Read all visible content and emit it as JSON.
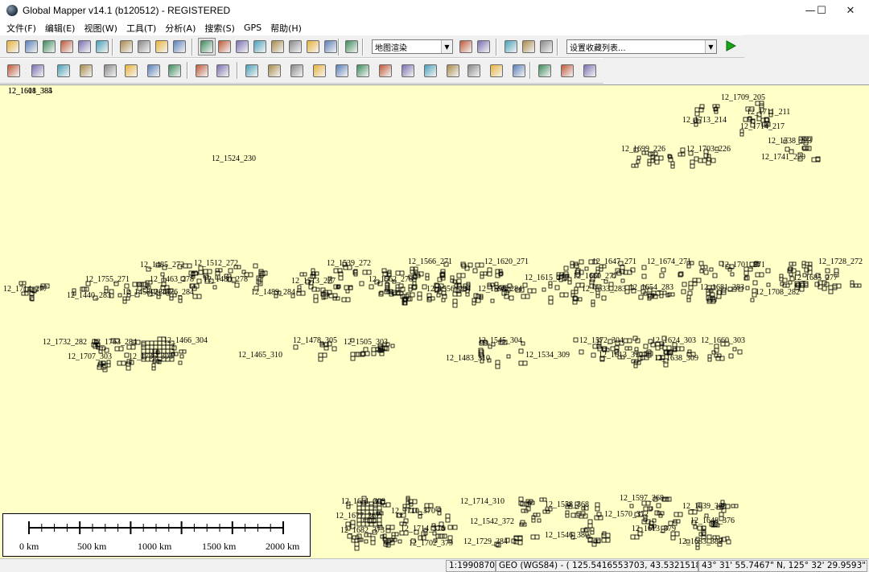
{
  "window": {
    "title": "Global Mapper v14.1 (b120512) - REGISTERED",
    "minimize": "—",
    "maximize": "☐",
    "close": "✕"
  },
  "menu": [
    "文件(F)",
    "编辑(E)",
    "视图(W)",
    "工具(T)",
    "分析(A)",
    "搜索(S)",
    "GPS",
    "帮助(H)"
  ],
  "toolbar": {
    "shader_select": "地图渲染",
    "bookmark_select": "设置收藏列表...",
    "go_icon": "play-icon"
  },
  "toolbar_icons_row1": [
    "open-folder-icon",
    "save-icon",
    "globe-icon",
    "layers-icon",
    "export-icon",
    "tools-icon",
    "zoom-in-icon",
    "zoom-out-icon",
    "zoom-full-icon",
    "home-icon",
    "select-icon",
    "pan-icon",
    "measure-icon",
    "info-icon",
    "digitize-icon",
    "path-profile-icon",
    "edit-icon",
    "shade-icon",
    "binoculars-icon",
    "shader-config-icon",
    "shader-3d-icon",
    "view-3d-icon",
    "picture-icon",
    "gps-icon"
  ],
  "toolbar_icons_row2": [
    "create-area-icon",
    "create-line-icon",
    "create-point-icon",
    "rotate-icon",
    "move-vertex-icon",
    "coordinates-icon",
    "edit-feature-icon",
    "grid-icon",
    "insert-vertex-icon",
    "delete-vertex-icon",
    "draw-icon",
    "reshape-icon",
    "combine-icon",
    "split-icon",
    "crop-icon",
    "buffer-icon",
    "trace-icon",
    "measure-area-icon",
    "smooth-icon",
    "simplify-icon",
    "join-icon",
    "fill-icon",
    "clip-icon",
    "offset-icon",
    "undo-icon",
    "redo-icon"
  ],
  "map": {
    "background_color": "#ffffc8",
    "tile_labels": [
      "12_1709_205",
      "12_1711_211",
      "12_1713_214",
      "12_1714_217",
      "12_1699_226",
      "12_1703_226",
      "12_1738_223",
      "12_1741_229",
      "12_1524_230",
      "12_1485_272",
      "12_1512_272",
      "12_1539_272",
      "12_1566_271",
      "12_1620_271",
      "12_1647_271",
      "12_1674_271",
      "12_1701_271",
      "12_1728_272",
      "12_1755_271",
      "12_1463_278",
      "12_1480_278",
      "12_1513_277",
      "12_1562_278",
      "12_1615_277",
      "12_1660_277",
      "12_1685_277",
      "12_1714_277",
      "12_1440_283",
      "12_1458_284",
      "12_1476_284",
      "12_1489_284",
      "12_1556_284",
      "12_1598_284",
      "12_1633_283",
      "12_1654_283",
      "12_1681_283",
      "12_1708_282",
      "12_1732_282",
      "12_1763_284",
      "12_1466_304",
      "12_1478_305",
      "12_1505_303",
      "12_1545_304",
      "12_1572_304",
      "12_1624_303",
      "12_1660_303",
      "12_1707_303",
      "12_1735_303",
      "12_1465_310",
      "12_1483_310",
      "12_1534_309",
      "12_1613_310",
      "12_1638_309",
      "12_1661_309",
      "12_1714_310",
      "12_1558_368",
      "12_1597_368",
      "12_1639_369",
      "12_1677_367",
      "12_1710_370",
      "12_1542_372",
      "12_1570_372",
      "12_1648_376",
      "12_1682_373",
      "12_1714_376",
      "12_1546_380",
      "12_1613_379",
      "12_1683_382",
      "12_1702_379",
      "12_1729_384",
      "12_1601_385",
      "12_1618_384"
    ]
  },
  "scale_bar": {
    "labels": [
      "0 km",
      "500 km",
      "1000 km",
      "1500 km",
      "2000 km"
    ]
  },
  "status": {
    "scale": "1:19908700",
    "projection": "GEO (WGS84) - ( 125.5416553703, 43.5321518679 )",
    "coords": "43° 31' 55.7467\" N, 125° 32' 29.9593\" E"
  }
}
